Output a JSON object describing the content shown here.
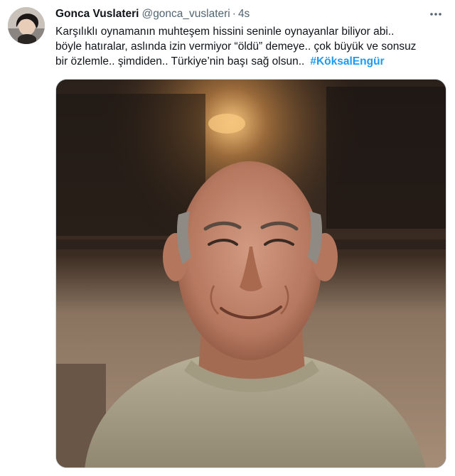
{
  "author": {
    "display_name": "Gonca Vuslateri",
    "handle": "@gonca_vuslateri",
    "separator": "·",
    "time": "4s"
  },
  "tweet": {
    "lines": [
      "Karşılıklı oynamanın muhteşem hissini seninle oynayanlar biliyor abi..",
      "böyle hatıralar, aslında izin vermiyor “öldü” demeye.. çok büyük ve sonsuz",
      "bir özlemle.. şimdiden.. Türkiye’nin başı sağ olsun.."
    ],
    "hashtag": "#KöksalEngür"
  },
  "icons": {
    "more": "more-dots-icon"
  },
  "colors": {
    "text": "#0f1419",
    "secondary": "#536471",
    "link": "#1d9bf0"
  }
}
